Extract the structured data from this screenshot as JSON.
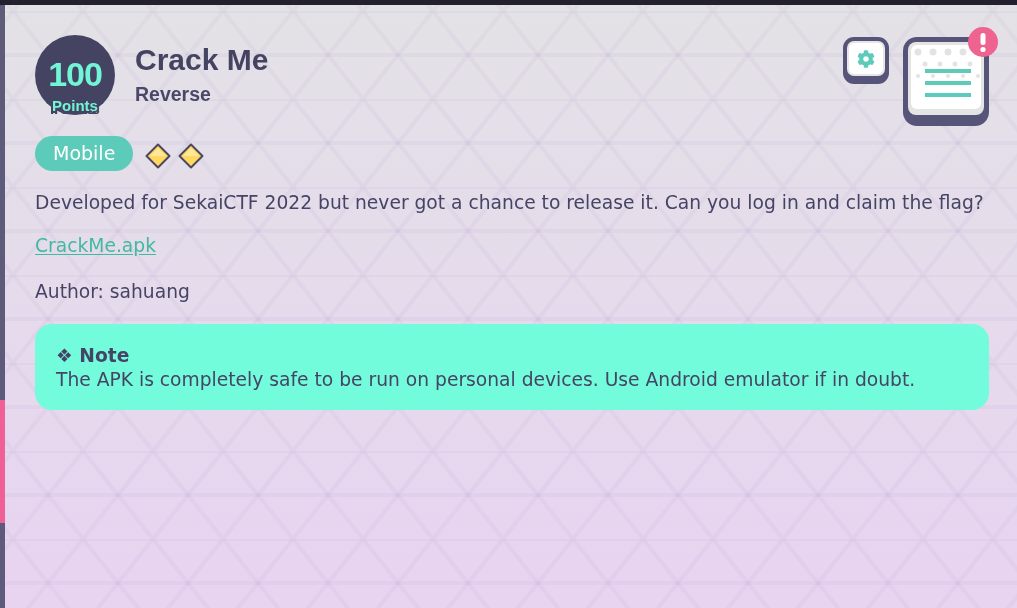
{
  "challenge": {
    "points": "100",
    "points_unit": "Points",
    "title": "Crack Me",
    "category": "Reverse",
    "tags": [
      "Mobile"
    ],
    "difficulty": [
      {
        "filled": true
      },
      {
        "filled": true
      }
    ],
    "description": "Developed for SekaiCTF 2022 but never got a chance to release it. Can you log in and claim the flag?",
    "attachments": [
      {
        "label": "CrackMe.apk"
      }
    ],
    "author": "Author: sahuang",
    "note": {
      "title": "❖ Note",
      "body": "The APK is completely safe to be run on personal devices. Use Android emulator if in doubt."
    }
  },
  "toolbar": {
    "notes_alert": true
  }
}
